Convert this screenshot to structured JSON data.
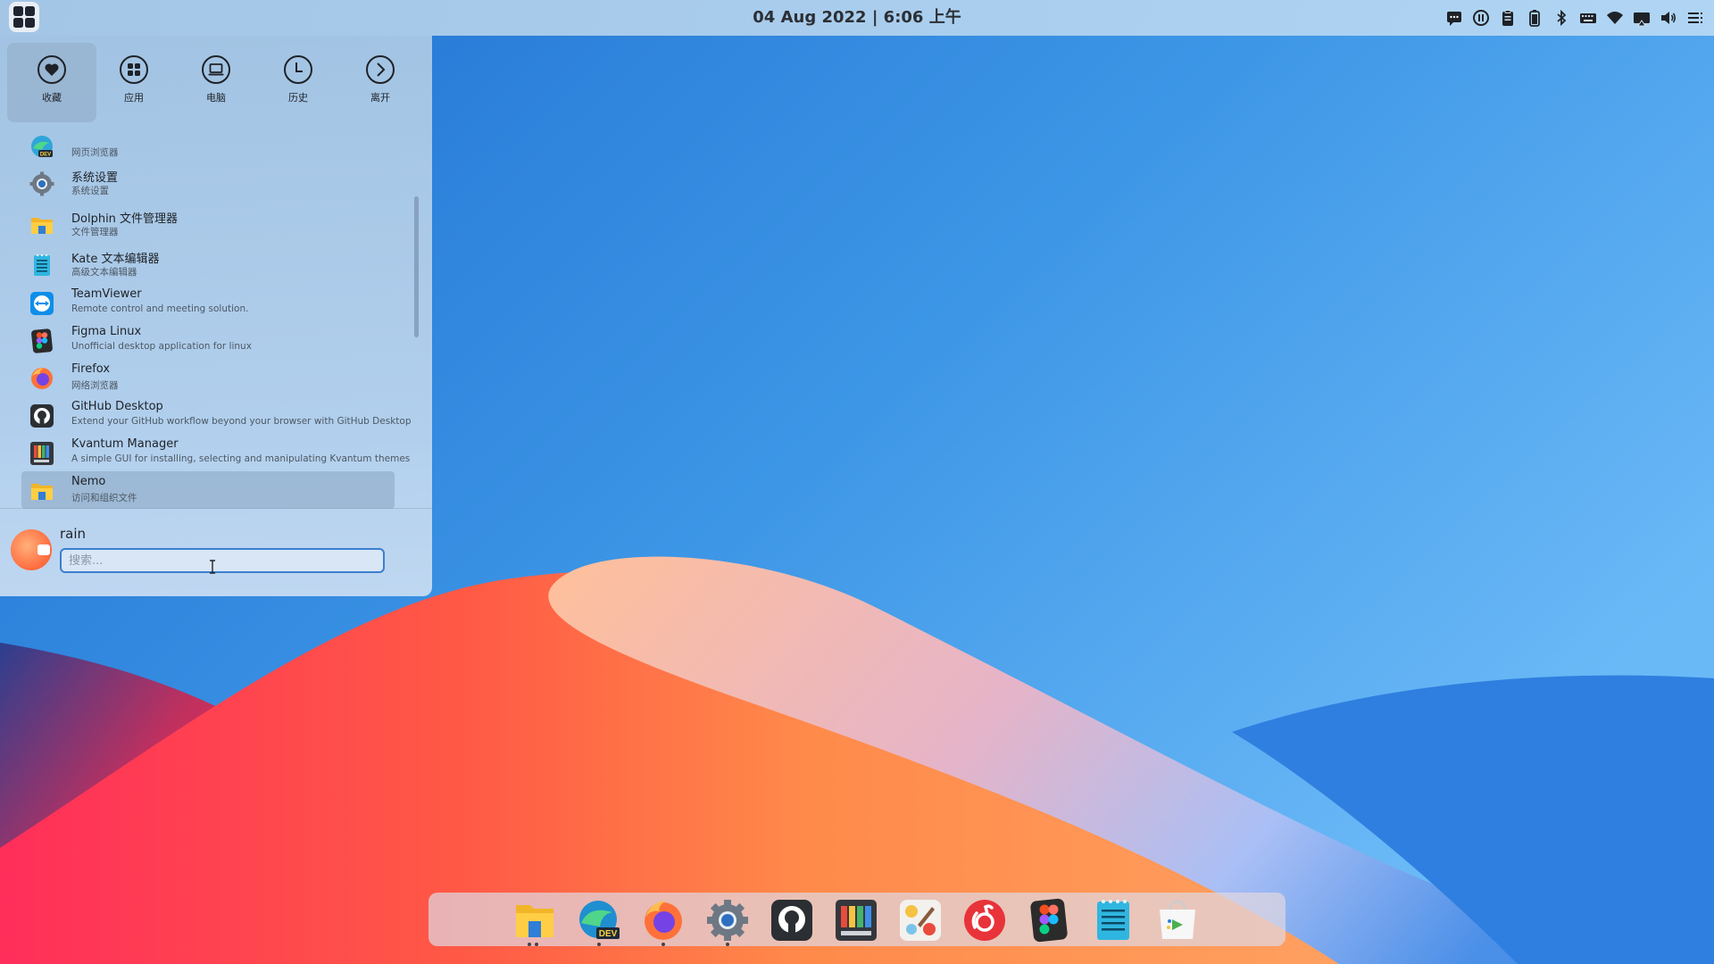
{
  "top_panel": {
    "clock": "04 Aug 2022 | 6:06 上午",
    "tray_icons": [
      "chat-icon",
      "pause-icon",
      "clipboard-icon",
      "battery-icon",
      "bluetooth-icon",
      "keyboard-icon",
      "wifi-icon",
      "display-icon",
      "volume-icon",
      "menu-icon"
    ]
  },
  "start_menu": {
    "tabs": [
      {
        "label": "收藏",
        "icon": "heart-icon",
        "active": true
      },
      {
        "label": "应用",
        "icon": "grid-icon",
        "active": false
      },
      {
        "label": "电脑",
        "icon": "laptop-icon",
        "active": false
      },
      {
        "label": "历史",
        "icon": "clock-icon",
        "active": false
      },
      {
        "label": "离开",
        "icon": "chevron-right-icon",
        "active": false
      }
    ],
    "apps": [
      {
        "name": "",
        "desc": "网页浏览器",
        "icon": "edge-dev-icon"
      },
      {
        "name": "系统设置",
        "desc": "系统设置",
        "icon": "settings-icon"
      },
      {
        "name": "Dolphin 文件管理器",
        "desc": "文件管理器",
        "icon": "folder-icon"
      },
      {
        "name": "Kate 文本编辑器",
        "desc": "高级文本编辑器",
        "icon": "kate-icon"
      },
      {
        "name": "TeamViewer",
        "desc": "Remote control and meeting solution.",
        "icon": "teamviewer-icon"
      },
      {
        "name": "Figma Linux",
        "desc": "Unofficial desktop application for linux",
        "icon": "figma-icon"
      },
      {
        "name": "Firefox",
        "desc": "网络浏览器",
        "icon": "firefox-icon"
      },
      {
        "name": "GitHub Desktop",
        "desc": "Extend your GitHub workflow beyond your browser with GitHub Desktop",
        "icon": "github-icon"
      },
      {
        "name": "Kvantum Manager",
        "desc": "A simple GUI for installing, selecting and manipulating Kvantum themes",
        "icon": "kvantum-icon"
      },
      {
        "name": "Nemo",
        "desc": "访问和组织文件",
        "icon": "folder-icon",
        "selected": true
      }
    ],
    "user": {
      "name": "rain"
    },
    "search": {
      "placeholder": "搜索..."
    }
  },
  "dock": {
    "items": [
      "files-icon",
      "edge-dev-icon",
      "firefox-icon",
      "settings-icon",
      "github-icon",
      "kvantum-icon",
      "color-picker-icon",
      "netease-music-icon",
      "figma-icon",
      "notes-icon",
      "store-icon"
    ]
  },
  "colors": {
    "accent": "#3a7fd0",
    "panel": "#b4d0ea"
  }
}
